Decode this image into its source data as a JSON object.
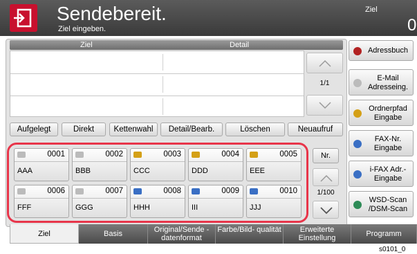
{
  "header": {
    "title": "Sendebereit.",
    "subtitle": "Ziel eingeben.",
    "ziel_label": "Ziel",
    "dest_count": "0"
  },
  "dest_table": {
    "col_ziel": "Ziel",
    "col_detail": "Detail",
    "page": "1/1"
  },
  "functions": [
    "Aufgelegt",
    "Direkt",
    "Kettenwahl",
    "Detail/Bearb.",
    "Löschen",
    "Neuaufruf"
  ],
  "keys": [
    {
      "num": "0001",
      "name": "AAA",
      "type": "mail"
    },
    {
      "num": "0002",
      "name": "BBB",
      "type": "mail"
    },
    {
      "num": "0003",
      "name": "CCC",
      "type": "folder"
    },
    {
      "num": "0004",
      "name": "DDD",
      "type": "folder"
    },
    {
      "num": "0005",
      "name": "EEE",
      "type": "folder"
    },
    {
      "num": "0006",
      "name": "FFF",
      "type": "mail"
    },
    {
      "num": "0007",
      "name": "GGG",
      "type": "mail"
    },
    {
      "num": "0008",
      "name": "HHH",
      "type": "fax"
    },
    {
      "num": "0009",
      "name": "III",
      "type": "fax"
    },
    {
      "num": "0010",
      "name": "JJJ",
      "type": "fax"
    }
  ],
  "key_nav": {
    "nr_label": "Nr.",
    "page": "1/100"
  },
  "side_buttons": [
    {
      "label": "Adressbuch",
      "icon": "address-book-icon",
      "color": "#b22222"
    },
    {
      "label": "E-Mail Adresseing.",
      "icon": "email-icon",
      "color": "#bbbbbb"
    },
    {
      "label": "Ordnerpfad Eingabe",
      "icon": "folder-icon",
      "color": "#d4a017"
    },
    {
      "label": "FAX-Nr. Eingabe",
      "icon": "fax-icon",
      "color": "#3a6fc4"
    },
    {
      "label": "i-FAX Adr.-Eingabe",
      "icon": "ifax-icon",
      "color": "#3a6fc4"
    },
    {
      "label": "WSD-Scan /DSM-Scan",
      "icon": "scan-icon",
      "color": "#2e8b57"
    }
  ],
  "tabs": [
    {
      "label": "Ziel"
    },
    {
      "label": "Basis"
    },
    {
      "label": "Original/Sende -datenformat"
    },
    {
      "label": "Farbe/Bild- qualität"
    },
    {
      "label": "Erweiterte Einstellung"
    },
    {
      "label": "Programm"
    }
  ],
  "footer_code": "s0101_0",
  "colors": {
    "accent": "#c8102e",
    "highlight": "#e8354a",
    "header_bg": "#474747"
  }
}
